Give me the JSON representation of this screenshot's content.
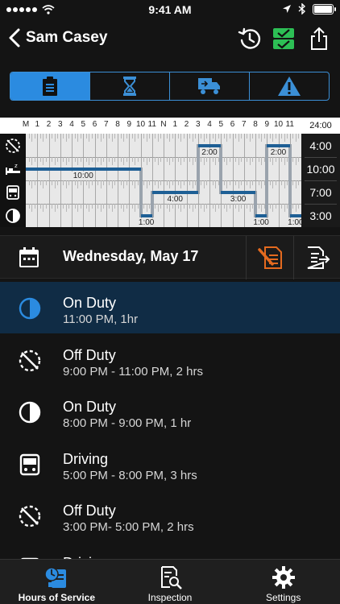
{
  "status_bar": {
    "time": "9:41 AM"
  },
  "nav": {
    "title": "Sam Casey"
  },
  "colors": {
    "accent": "#2b8be0",
    "selected_row": "#102c45",
    "bar": "#1e5f95",
    "warning": "#e46a1f",
    "check_green": "#2dbf55"
  },
  "segments": [
    {
      "icon": "clipboard-icon",
      "active": true
    },
    {
      "icon": "hourglass-icon",
      "active": false
    },
    {
      "icon": "truck-icon",
      "active": false
    },
    {
      "icon": "warning-icon",
      "active": false
    }
  ],
  "grid": {
    "hour_labels": [
      "M",
      "1",
      "2",
      "3",
      "4",
      "5",
      "6",
      "7",
      "8",
      "9",
      "10",
      "11",
      "N",
      "1",
      "2",
      "3",
      "4",
      "5",
      "6",
      "7",
      "8",
      "9",
      "10",
      "11"
    ],
    "total_header": "24:00",
    "lanes": [
      {
        "name": "Off Duty",
        "icon": "off-duty-icon",
        "total": "4:00"
      },
      {
        "name": "Sleeper",
        "icon": "sleeper-icon",
        "total": "10:00"
      },
      {
        "name": "Driving",
        "icon": "driving-icon",
        "total": "7:00"
      },
      {
        "name": "On Duty",
        "icon": "on-duty-icon",
        "total": "3:00"
      }
    ],
    "segments": [
      {
        "lane": 1,
        "start": 0,
        "end": 10,
        "label": "10:00"
      },
      {
        "lane": 3,
        "start": 10,
        "end": 11,
        "label": "1:00"
      },
      {
        "lane": 2,
        "start": 11,
        "end": 15,
        "label": "4:00"
      },
      {
        "lane": 0,
        "start": 15,
        "end": 17,
        "label": "2:00"
      },
      {
        "lane": 2,
        "start": 17,
        "end": 20,
        "label": "3:00"
      },
      {
        "lane": 3,
        "start": 20,
        "end": 21,
        "label": "1:00"
      },
      {
        "lane": 0,
        "start": 21,
        "end": 23,
        "label": "2:00"
      },
      {
        "lane": 3,
        "start": 23,
        "end": 24,
        "label": "1:00"
      }
    ]
  },
  "date_bar": {
    "date": "Wednesday, May 17"
  },
  "events": [
    {
      "title": "On Duty",
      "sub": "11:00 PM, 1hr",
      "icon": "on-duty-icon",
      "selected": true
    },
    {
      "title": "Off Duty",
      "sub": "9:00 PM - 11:00 PM, 2 hrs",
      "icon": "off-duty-icon",
      "selected": false
    },
    {
      "title": "On Duty",
      "sub": "8:00 PM - 9:00 PM, 1 hr",
      "icon": "on-duty-icon",
      "selected": false
    },
    {
      "title": "Driving",
      "sub": "5:00 PM - 8:00 PM, 3 hrs",
      "icon": "driving-icon",
      "selected": false
    },
    {
      "title": "Off Duty",
      "sub": "3:00 PM- 5:00 PM, 2 hrs",
      "icon": "off-duty-icon",
      "selected": false
    },
    {
      "title": "Driving",
      "sub": "",
      "icon": "driving-icon",
      "selected": false
    }
  ],
  "tabs": [
    {
      "label": "Hours of Service",
      "icon": "hours-of-service-icon",
      "active": true
    },
    {
      "label": "Inspection",
      "icon": "inspection-icon",
      "active": false
    },
    {
      "label": "Settings",
      "icon": "gear-icon",
      "active": false
    }
  ]
}
